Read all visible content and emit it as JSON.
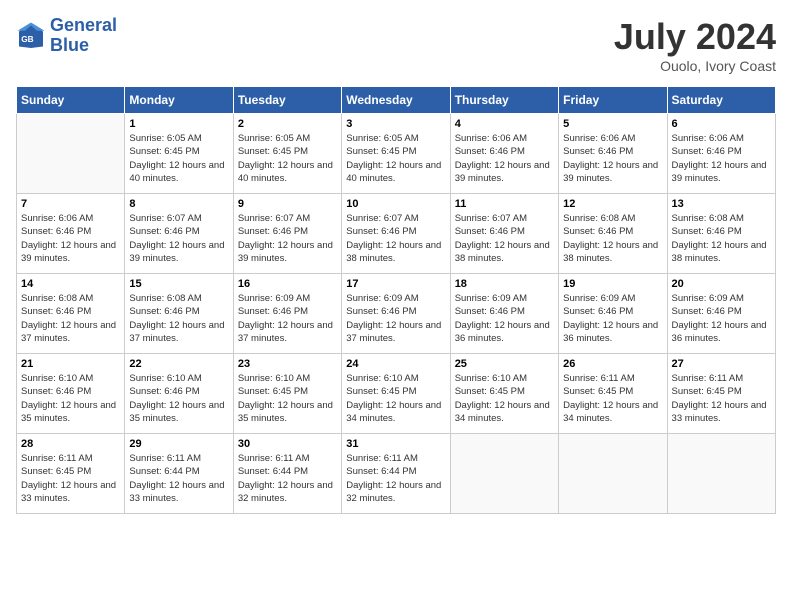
{
  "header": {
    "logo_line1": "General",
    "logo_line2": "Blue",
    "month": "July 2024",
    "location": "Ouolo, Ivory Coast"
  },
  "weekdays": [
    "Sunday",
    "Monday",
    "Tuesday",
    "Wednesday",
    "Thursday",
    "Friday",
    "Saturday"
  ],
  "weeks": [
    [
      {
        "day": "",
        "sunrise": "",
        "sunset": "",
        "daylight": ""
      },
      {
        "day": "1",
        "sunrise": "Sunrise: 6:05 AM",
        "sunset": "Sunset: 6:45 PM",
        "daylight": "Daylight: 12 hours and 40 minutes."
      },
      {
        "day": "2",
        "sunrise": "Sunrise: 6:05 AM",
        "sunset": "Sunset: 6:45 PM",
        "daylight": "Daylight: 12 hours and 40 minutes."
      },
      {
        "day": "3",
        "sunrise": "Sunrise: 6:05 AM",
        "sunset": "Sunset: 6:45 PM",
        "daylight": "Daylight: 12 hours and 40 minutes."
      },
      {
        "day": "4",
        "sunrise": "Sunrise: 6:06 AM",
        "sunset": "Sunset: 6:46 PM",
        "daylight": "Daylight: 12 hours and 39 minutes."
      },
      {
        "day": "5",
        "sunrise": "Sunrise: 6:06 AM",
        "sunset": "Sunset: 6:46 PM",
        "daylight": "Daylight: 12 hours and 39 minutes."
      },
      {
        "day": "6",
        "sunrise": "Sunrise: 6:06 AM",
        "sunset": "Sunset: 6:46 PM",
        "daylight": "Daylight: 12 hours and 39 minutes."
      }
    ],
    [
      {
        "day": "7",
        "sunrise": "Sunrise: 6:06 AM",
        "sunset": "Sunset: 6:46 PM",
        "daylight": "Daylight: 12 hours and 39 minutes."
      },
      {
        "day": "8",
        "sunrise": "Sunrise: 6:07 AM",
        "sunset": "Sunset: 6:46 PM",
        "daylight": "Daylight: 12 hours and 39 minutes."
      },
      {
        "day": "9",
        "sunrise": "Sunrise: 6:07 AM",
        "sunset": "Sunset: 6:46 PM",
        "daylight": "Daylight: 12 hours and 39 minutes."
      },
      {
        "day": "10",
        "sunrise": "Sunrise: 6:07 AM",
        "sunset": "Sunset: 6:46 PM",
        "daylight": "Daylight: 12 hours and 38 minutes."
      },
      {
        "day": "11",
        "sunrise": "Sunrise: 6:07 AM",
        "sunset": "Sunset: 6:46 PM",
        "daylight": "Daylight: 12 hours and 38 minutes."
      },
      {
        "day": "12",
        "sunrise": "Sunrise: 6:08 AM",
        "sunset": "Sunset: 6:46 PM",
        "daylight": "Daylight: 12 hours and 38 minutes."
      },
      {
        "day": "13",
        "sunrise": "Sunrise: 6:08 AM",
        "sunset": "Sunset: 6:46 PM",
        "daylight": "Daylight: 12 hours and 38 minutes."
      }
    ],
    [
      {
        "day": "14",
        "sunrise": "Sunrise: 6:08 AM",
        "sunset": "Sunset: 6:46 PM",
        "daylight": "Daylight: 12 hours and 37 minutes."
      },
      {
        "day": "15",
        "sunrise": "Sunrise: 6:08 AM",
        "sunset": "Sunset: 6:46 PM",
        "daylight": "Daylight: 12 hours and 37 minutes."
      },
      {
        "day": "16",
        "sunrise": "Sunrise: 6:09 AM",
        "sunset": "Sunset: 6:46 PM",
        "daylight": "Daylight: 12 hours and 37 minutes."
      },
      {
        "day": "17",
        "sunrise": "Sunrise: 6:09 AM",
        "sunset": "Sunset: 6:46 PM",
        "daylight": "Daylight: 12 hours and 37 minutes."
      },
      {
        "day": "18",
        "sunrise": "Sunrise: 6:09 AM",
        "sunset": "Sunset: 6:46 PM",
        "daylight": "Daylight: 12 hours and 36 minutes."
      },
      {
        "day": "19",
        "sunrise": "Sunrise: 6:09 AM",
        "sunset": "Sunset: 6:46 PM",
        "daylight": "Daylight: 12 hours and 36 minutes."
      },
      {
        "day": "20",
        "sunrise": "Sunrise: 6:09 AM",
        "sunset": "Sunset: 6:46 PM",
        "daylight": "Daylight: 12 hours and 36 minutes."
      }
    ],
    [
      {
        "day": "21",
        "sunrise": "Sunrise: 6:10 AM",
        "sunset": "Sunset: 6:46 PM",
        "daylight": "Daylight: 12 hours and 35 minutes."
      },
      {
        "day": "22",
        "sunrise": "Sunrise: 6:10 AM",
        "sunset": "Sunset: 6:46 PM",
        "daylight": "Daylight: 12 hours and 35 minutes."
      },
      {
        "day": "23",
        "sunrise": "Sunrise: 6:10 AM",
        "sunset": "Sunset: 6:45 PM",
        "daylight": "Daylight: 12 hours and 35 minutes."
      },
      {
        "day": "24",
        "sunrise": "Sunrise: 6:10 AM",
        "sunset": "Sunset: 6:45 PM",
        "daylight": "Daylight: 12 hours and 34 minutes."
      },
      {
        "day": "25",
        "sunrise": "Sunrise: 6:10 AM",
        "sunset": "Sunset: 6:45 PM",
        "daylight": "Daylight: 12 hours and 34 minutes."
      },
      {
        "day": "26",
        "sunrise": "Sunrise: 6:11 AM",
        "sunset": "Sunset: 6:45 PM",
        "daylight": "Daylight: 12 hours and 34 minutes."
      },
      {
        "day": "27",
        "sunrise": "Sunrise: 6:11 AM",
        "sunset": "Sunset: 6:45 PM",
        "daylight": "Daylight: 12 hours and 33 minutes."
      }
    ],
    [
      {
        "day": "28",
        "sunrise": "Sunrise: 6:11 AM",
        "sunset": "Sunset: 6:45 PM",
        "daylight": "Daylight: 12 hours and 33 minutes."
      },
      {
        "day": "29",
        "sunrise": "Sunrise: 6:11 AM",
        "sunset": "Sunset: 6:44 PM",
        "daylight": "Daylight: 12 hours and 33 minutes."
      },
      {
        "day": "30",
        "sunrise": "Sunrise: 6:11 AM",
        "sunset": "Sunset: 6:44 PM",
        "daylight": "Daylight: 12 hours and 32 minutes."
      },
      {
        "day": "31",
        "sunrise": "Sunrise: 6:11 AM",
        "sunset": "Sunset: 6:44 PM",
        "daylight": "Daylight: 12 hours and 32 minutes."
      },
      {
        "day": "",
        "sunrise": "",
        "sunset": "",
        "daylight": ""
      },
      {
        "day": "",
        "sunrise": "",
        "sunset": "",
        "daylight": ""
      },
      {
        "day": "",
        "sunrise": "",
        "sunset": "",
        "daylight": ""
      }
    ]
  ]
}
